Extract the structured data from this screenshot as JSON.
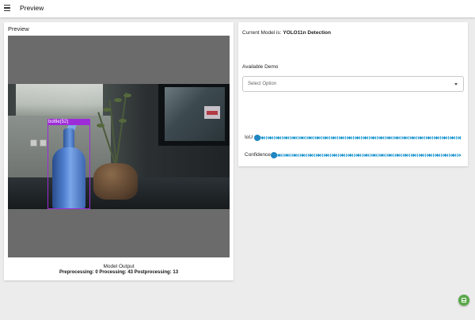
{
  "header": {
    "title": "Preview",
    "menu_icon": "hamburger-menu-icon"
  },
  "preview": {
    "heading": "Preview",
    "detection": {
      "label": "bottle(52)",
      "color": "#9d2cd8"
    },
    "model_output_label": "Model Output",
    "stats": "Preprocessing: 0 Processing: 43 Postprocessing: 13"
  },
  "controls": {
    "current_model_prefix": "Current Model is:",
    "current_model_name": "YOLO11n Detection",
    "available_demo_label": "Available Demo",
    "select": {
      "value": "Select Option"
    },
    "sliders": [
      {
        "label": "IoU",
        "value": 0
      },
      {
        "label": "Confidence",
        "value": 0
      }
    ],
    "accent_color": "#1f86c1"
  },
  "fab": {
    "icon": "calendar-icon",
    "color": "#5aa84a"
  }
}
